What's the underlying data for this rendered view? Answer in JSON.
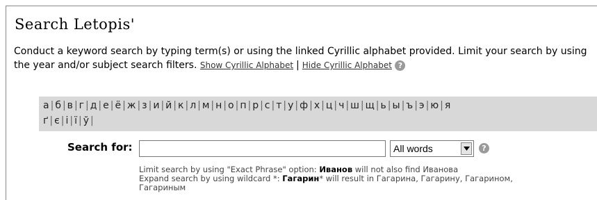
{
  "title": "Search Letopis'",
  "intro": {
    "text": "Conduct a keyword search by typing term(s) or using the linked Cyrillic alphabet provided. Limit your search by using the year and/or subject search filters.",
    "show_link": "Show Cyrillic Alphabet",
    "separator": "|",
    "hide_link": "Hide Cyrillic Alphabet",
    "help_icon": "?"
  },
  "alphabet": {
    "row1": [
      "а",
      "б",
      "в",
      "г",
      "д",
      "е",
      "ё",
      "ж",
      "з",
      "и",
      "й",
      "к",
      "л",
      "м",
      "н",
      "о",
      "п",
      "р",
      "с",
      "т",
      "у",
      "ф",
      "х",
      "ц",
      "ч",
      "ш",
      "щ",
      "ь",
      "ы",
      "ъ",
      "э",
      "ю",
      "я"
    ],
    "row2": [
      "ґ",
      "є",
      "і",
      "ї",
      "ў"
    ]
  },
  "search": {
    "label": "Search for:",
    "value": "",
    "mode_selected": "All words",
    "help_icon": "?"
  },
  "hints": {
    "line1_pre": "Limit search by using \"Exact Phrase\" option: ",
    "line1_bold": "Иванов",
    "line1_post": " will not also find Иванова",
    "line2_pre": "Expand search by using wildcard *: ",
    "line2_bold": "Гагарин",
    "line2_post": "* will result in Гагарина, Гагарину, Гагарином,",
    "line3": "Гагариным"
  }
}
